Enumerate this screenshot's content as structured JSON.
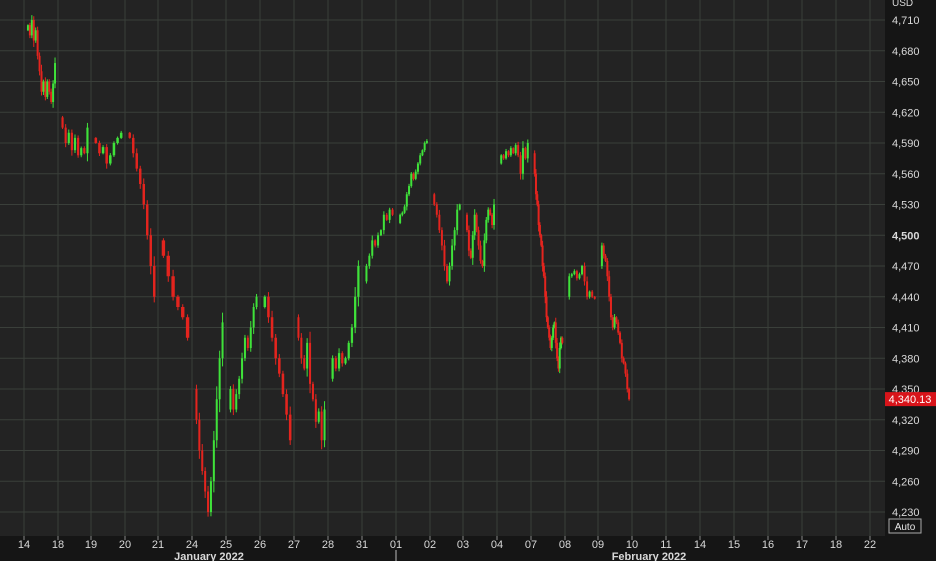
{
  "chart_data": {
    "type": "candlestick",
    "currency_label": "USD",
    "current_price_label": "4,340.13",
    "current_price": 4340.13,
    "scale_mode": "Auto",
    "ylim": [
      4215,
      4725
    ],
    "y_ticks": [
      {
        "value": 4710,
        "label": "4,710",
        "bold": false
      },
      {
        "value": 4680,
        "label": "4,680",
        "bold": false
      },
      {
        "value": 4650,
        "label": "4,650",
        "bold": false
      },
      {
        "value": 4620,
        "label": "4,620",
        "bold": false
      },
      {
        "value": 4590,
        "label": "4,590",
        "bold": false
      },
      {
        "value": 4560,
        "label": "4,560",
        "bold": false
      },
      {
        "value": 4530,
        "label": "4,530",
        "bold": false
      },
      {
        "value": 4500,
        "label": "4,500",
        "bold": true
      },
      {
        "value": 4470,
        "label": "4,470",
        "bold": false
      },
      {
        "value": 4440,
        "label": "4,440",
        "bold": false
      },
      {
        "value": 4410,
        "label": "4,410",
        "bold": false
      },
      {
        "value": 4380,
        "label": "4,380",
        "bold": false
      },
      {
        "value": 4350,
        "label": "4,350",
        "bold": false
      },
      {
        "value": 4320,
        "label": "4,320",
        "bold": false
      },
      {
        "value": 4290,
        "label": "4,290",
        "bold": false
      },
      {
        "value": 4260,
        "label": "4,260",
        "bold": false
      },
      {
        "value": 4230,
        "label": "4,230",
        "bold": false
      }
    ],
    "x_ticks": [
      "14",
      "18",
      "19",
      "20",
      "21",
      "24",
      "25",
      "26",
      "27",
      "28",
      "31",
      "01",
      "02",
      "03",
      "04",
      "07",
      "08",
      "09",
      "10",
      "11",
      "14",
      "15",
      "16",
      "17",
      "18",
      "22"
    ],
    "month_labels": [
      {
        "label": "January 2022",
        "at_tick": 5.5
      },
      {
        "label": "February 2022",
        "at_tick": 18.5
      }
    ],
    "month_separator_at_tick": 11,
    "grid": true,
    "colors": {
      "up": "#3fe23a",
      "down": "#e4241e",
      "grid": "#3a3f3a",
      "price_tag": "#d8141a"
    },
    "series": [
      {
        "day": 0,
        "points": [
          4700,
          4705,
          4695,
          4710,
          4690,
          4700,
          4675,
          4660,
          4640,
          4650,
          4635,
          4650,
          4640,
          4630,
          4648,
          4668
        ]
      },
      {
        "day": 1,
        "points": [
          4615,
          4605,
          4590,
          4600,
          4583,
          4595,
          4578,
          4585,
          4580,
          4605
        ]
      },
      {
        "day": 2,
        "points": [
          4595,
          4590,
          4580,
          4586,
          4570,
          4578,
          4590,
          4595,
          4600
        ]
      },
      {
        "day": 3,
        "points": [
          4600,
          4595,
          4580,
          4565,
          4550,
          4530,
          4500,
          4470,
          4440
        ]
      },
      {
        "day": 4,
        "points": [
          4495,
          4480,
          4460,
          4440,
          4430,
          4420,
          4400
        ]
      },
      {
        "day": 5,
        "points": [
          4350,
          4320,
          4290,
          4270,
          4250,
          4230,
          4260,
          4300,
          4340,
          4380,
          4415
        ]
      },
      {
        "day": 6,
        "points": [
          4330,
          4350,
          4330,
          4345,
          4360,
          4380,
          4400,
          4390,
          4410,
          4430,
          4440
        ]
      },
      {
        "day": 7,
        "points": [
          4430,
          4440,
          4420,
          4400,
          4380,
          4365,
          4345,
          4325,
          4300
        ]
      },
      {
        "day": 8,
        "points": [
          4420,
          4400,
          4380,
          4370,
          4395,
          4355,
          4340,
          4318,
          4328,
          4300,
          4330
        ]
      },
      {
        "day": 9,
        "points": [
          4360,
          4380,
          4370,
          4385,
          4375,
          4380,
          4395,
          4410,
          4440,
          4470
        ]
      },
      {
        "day": 10,
        "points": [
          4455,
          4470,
          4480,
          4495,
          4490,
          4500,
          4505,
          4520,
          4515,
          4525,
          4520
        ]
      },
      {
        "day": 11,
        "points": [
          4512,
          4520,
          4522,
          4528,
          4540,
          4548,
          4560,
          4555,
          4562,
          4570,
          4578,
          4583,
          4590,
          4592
        ]
      },
      {
        "day": 12,
        "points": [
          4540,
          4530,
          4520,
          4505,
          4490,
          4470,
          4455,
          4470,
          4490,
          4505,
          4525,
          4530
        ]
      },
      {
        "day": 13,
        "points": [
          4520,
          4505,
          4485,
          4478,
          4500,
          4520,
          4505,
          4490,
          4475,
          4470,
          4495,
          4515,
          4525,
          4520,
          4510,
          4530
        ]
      },
      {
        "day": 14,
        "points": [
          4570,
          4578,
          4575,
          4582,
          4578,
          4585,
          4580,
          4588,
          4578,
          4560,
          4585,
          4575,
          4590
        ]
      },
      {
        "day": 15,
        "points": [
          4580,
          4560,
          4540,
          4530,
          4510,
          4500,
          4490,
          4470,
          4460,
          4440,
          4420,
          4410,
          4400,
          4390,
          4400,
          4410,
          4415,
          4395,
          4380,
          4370,
          4390,
          4400,
          4395
        ]
      },
      {
        "day": 16,
        "points": [
          4440,
          4460,
          4462,
          4465,
          4458,
          4462,
          4470,
          4455,
          4440,
          4445,
          4440,
          4438
        ]
      },
      {
        "day": 17,
        "points": [
          4470,
          4490,
          4480,
          4475,
          4460,
          4440,
          4420,
          4410,
          4420,
          4415,
          4405,
          4395,
          4380,
          4375,
          4365,
          4350,
          4340
        ]
      }
    ]
  }
}
